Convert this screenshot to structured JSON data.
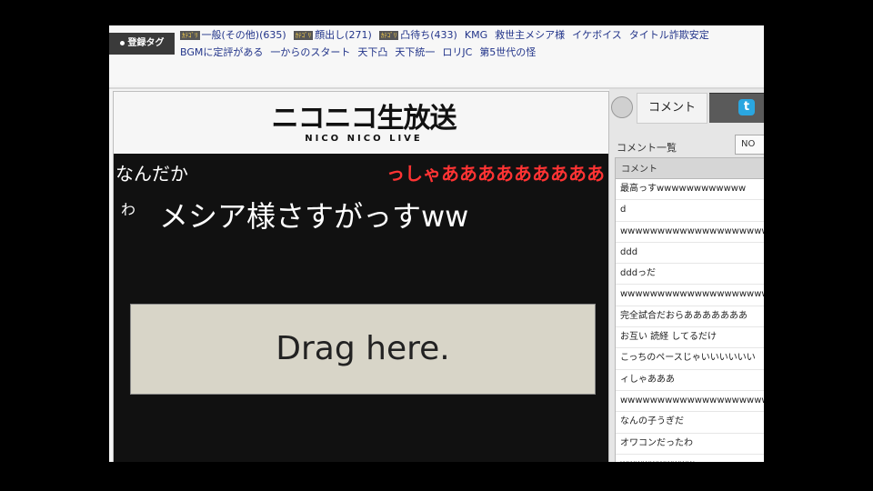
{
  "tags": {
    "heading": "登録タグ",
    "row1": [
      {
        "cat": "ｶﾃｺﾞﾘ",
        "label": "一般(その他)(635)"
      },
      {
        "cat": "ｶﾃｺﾞﾘ",
        "label": "顔出し(271)"
      },
      {
        "cat": "ｶﾃｺﾞﾘ",
        "label": "凸待ち(433)"
      },
      {
        "label": "KMG"
      },
      {
        "label": "救世主メシア様"
      },
      {
        "label": "イケボイス"
      },
      {
        "label": "タイトル詐欺安定"
      }
    ],
    "row2": [
      "BGMに定評がある",
      "一からのスタート",
      "天下凸",
      "天下統一",
      "ロリJC",
      "第5世代の怪"
    ]
  },
  "player": {
    "logo_main": "ニコニコ生放送",
    "logo_sub": "NICO NICO LIVE",
    "messages": {
      "m1": "なんだか",
      "m2": "っしゃあああああああああ",
      "m3": "わ",
      "m4": "メシア様さすがっすww"
    },
    "drag_label": "Drag here."
  },
  "panel": {
    "tab_comment": "コメント",
    "tab_twitter_icon": "twitter-icon",
    "list_title": "コメント一覧",
    "no_label": "NO",
    "header": "コメント",
    "comments": [
      "最高っすwwwwwwwwwwww",
      "d",
      "wwwwwwwwwwwwwwwwwwwwww",
      "ddd",
      "dddっだ",
      "wwwwwwwwwwwwwwwwwwwwww",
      "完全試合だおらあああああああ",
      "お互い 読経 してるだけ",
      "こっちのペースじゃいいいいいい",
      "ィしゃあああ",
      "wwwwwwwwwwwwwwwwwwwwww",
      "なんの子うぎだ",
      "オワコンだったわ",
      "wwwwwwwwww"
    ]
  }
}
